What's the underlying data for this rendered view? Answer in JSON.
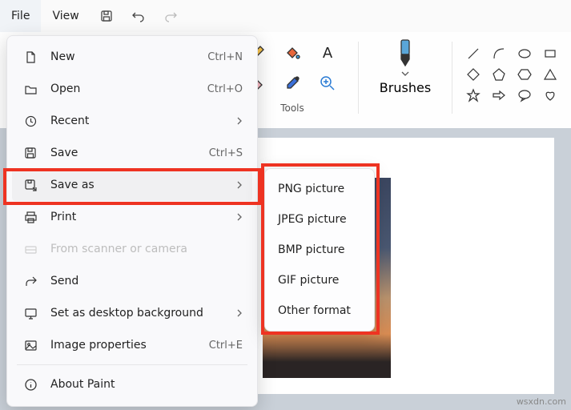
{
  "menubar": {
    "file": "File",
    "view": "View"
  },
  "ribbon": {
    "tools_label": "Tools",
    "brushes_label": "Brushes"
  },
  "dropdown": {
    "new": {
      "label": "New",
      "shortcut": "Ctrl+N"
    },
    "open": {
      "label": "Open",
      "shortcut": "Ctrl+O"
    },
    "recent": {
      "label": "Recent"
    },
    "save": {
      "label": "Save",
      "shortcut": "Ctrl+S"
    },
    "saveas": {
      "label": "Save as"
    },
    "print": {
      "label": "Print"
    },
    "scanner": {
      "label": "From scanner or camera"
    },
    "send": {
      "label": "Send"
    },
    "desktopbg": {
      "label": "Set as desktop background"
    },
    "props": {
      "label": "Image properties",
      "shortcut": "Ctrl+E"
    },
    "about": {
      "label": "About Paint"
    }
  },
  "submenu": {
    "png": "PNG picture",
    "jpeg": "JPEG picture",
    "bmp": "BMP picture",
    "gif": "GIF picture",
    "other": "Other format"
  },
  "watermark": "wsxdn.com"
}
